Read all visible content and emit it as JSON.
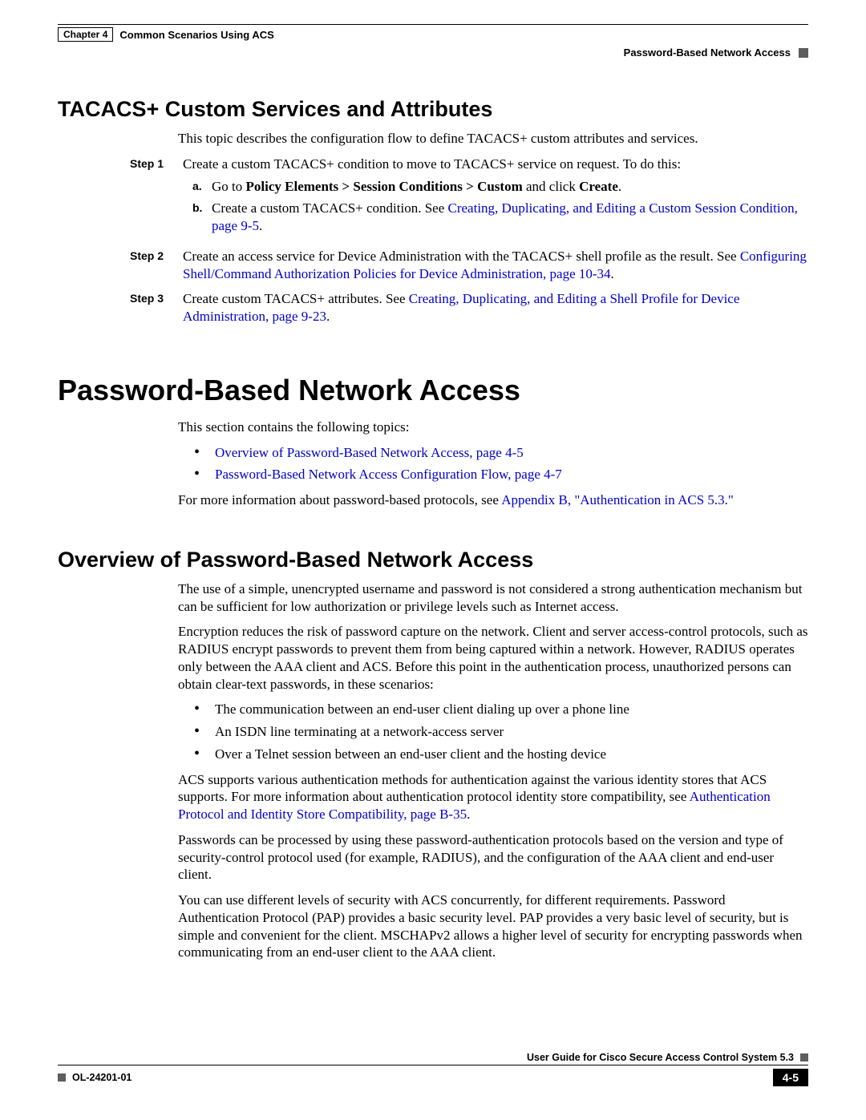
{
  "header": {
    "chapter_word": "Chapter",
    "chapter_num": "4",
    "chapter_title": "Common Scenarios Using ACS",
    "section_right": "Password-Based Network Access"
  },
  "sec1": {
    "heading": "TACACS+ Custom Services and Attributes",
    "intro": "This topic describes the configuration flow to define TACACS+ custom attributes and services.",
    "step1": {
      "label": "Step 1",
      "text": "Create a custom TACACS+ condition to move to TACACS+ service on request. To do this:",
      "a": {
        "label": "a.",
        "pre": "Go to ",
        "bold": "Policy Elements > Session Conditions > Custom",
        "mid": " and click ",
        "bold2": "Create",
        "post": "."
      },
      "b": {
        "label": "b.",
        "pre": "Create a custom TACACS+ condition. See ",
        "link": "Creating, Duplicating, and Editing a Custom Session Condition, page 9-5",
        "post": "."
      }
    },
    "step2": {
      "label": "Step 2",
      "pre": "Create an access service for Device Administration with the TACACS+ shell profile as the result. See ",
      "link": "Configuring Shell/Command Authorization Policies for Device Administration, page 10-34",
      "post": "."
    },
    "step3": {
      "label": "Step 3",
      "pre": "Create custom TACACS+ attributes. See ",
      "link": "Creating, Duplicating, and Editing a Shell Profile for Device Administration, page 9-23",
      "post": "."
    }
  },
  "sec2": {
    "heading": "Password-Based Network Access",
    "intro": "This section contains the following topics:",
    "bullets": [
      "Overview of Password-Based Network Access, page 4-5",
      "Password-Based Network Access Configuration Flow, page 4-7"
    ],
    "more_pre": "For more information about password-based protocols, see ",
    "more_link": "Appendix B, \"Authentication in ACS 5.3.\""
  },
  "sec3": {
    "heading": "Overview of Password-Based Network Access",
    "p1": "The use of a simple, unencrypted username and password is not considered a strong authentication mechanism but can be sufficient for low authorization or privilege levels such as Internet access.",
    "p2": "Encryption reduces the risk of password capture on the network. Client and server access-control protocols, such as RADIUS encrypt passwords to prevent them from being captured within a network. However, RADIUS operates only between the AAA client and ACS. Before this point in the authentication process, unauthorized persons can obtain clear-text passwords, in these scenarios:",
    "bullets": [
      "The communication between an end-user client dialing up over a phone line",
      "An ISDN line terminating at a network-access server",
      "Over a Telnet session between an end-user client and the hosting device"
    ],
    "p3_pre": "ACS supports various authentication methods for authentication against the various identity stores that ACS supports. For more information about authentication protocol identity store compatibility, see ",
    "p3_link": "Authentication Protocol and Identity Store Compatibility, page B-35",
    "p3_post": ".",
    "p4": "Passwords can be processed by using these password-authentication protocols based on the version and type of security-control protocol used (for example, RADIUS), and the configuration of the AAA client and end-user client.",
    "p5": "You can use different levels of security with ACS concurrently, for different requirements. Password Authentication Protocol (PAP) provides a basic security level. PAP provides a very basic level of security, but is simple and convenient for the client. MSCHAPv2 allows a higher level of security for encrypting passwords when communicating from an end-user client to the AAA client."
  },
  "footer": {
    "guide": "User Guide for Cisco Secure Access Control System 5.3",
    "doc_id": "OL-24201-01",
    "page": "4-5"
  }
}
